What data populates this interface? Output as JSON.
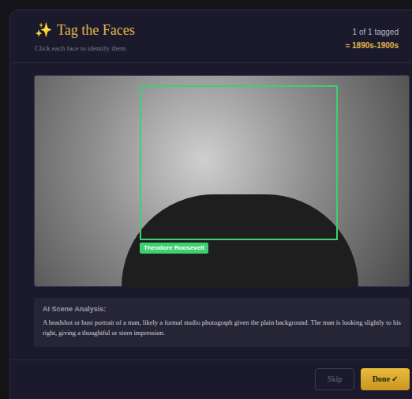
{
  "dialog": {
    "icon": "✨",
    "title": "Tag the Faces",
    "subtitle": "Click each face to identify them",
    "tagged_count": "1 of 1 tagged",
    "era": "≈ 1890s-1900s"
  },
  "photo": {
    "faces": [
      {
        "label": "Theodore Roosevelt",
        "tagged": true
      }
    ]
  },
  "analysis": {
    "title": "AI Scene Analysis:",
    "text": "A headshot or bust portrait of a man, likely a formal studio photograph given the plain background. The man is looking slightly to his right, giving a thoughtful or stern impression."
  },
  "buttons": [
    {
      "label": "Skip",
      "kind": "secondary"
    },
    {
      "label": "Done ✓",
      "kind": "primary"
    }
  ]
}
